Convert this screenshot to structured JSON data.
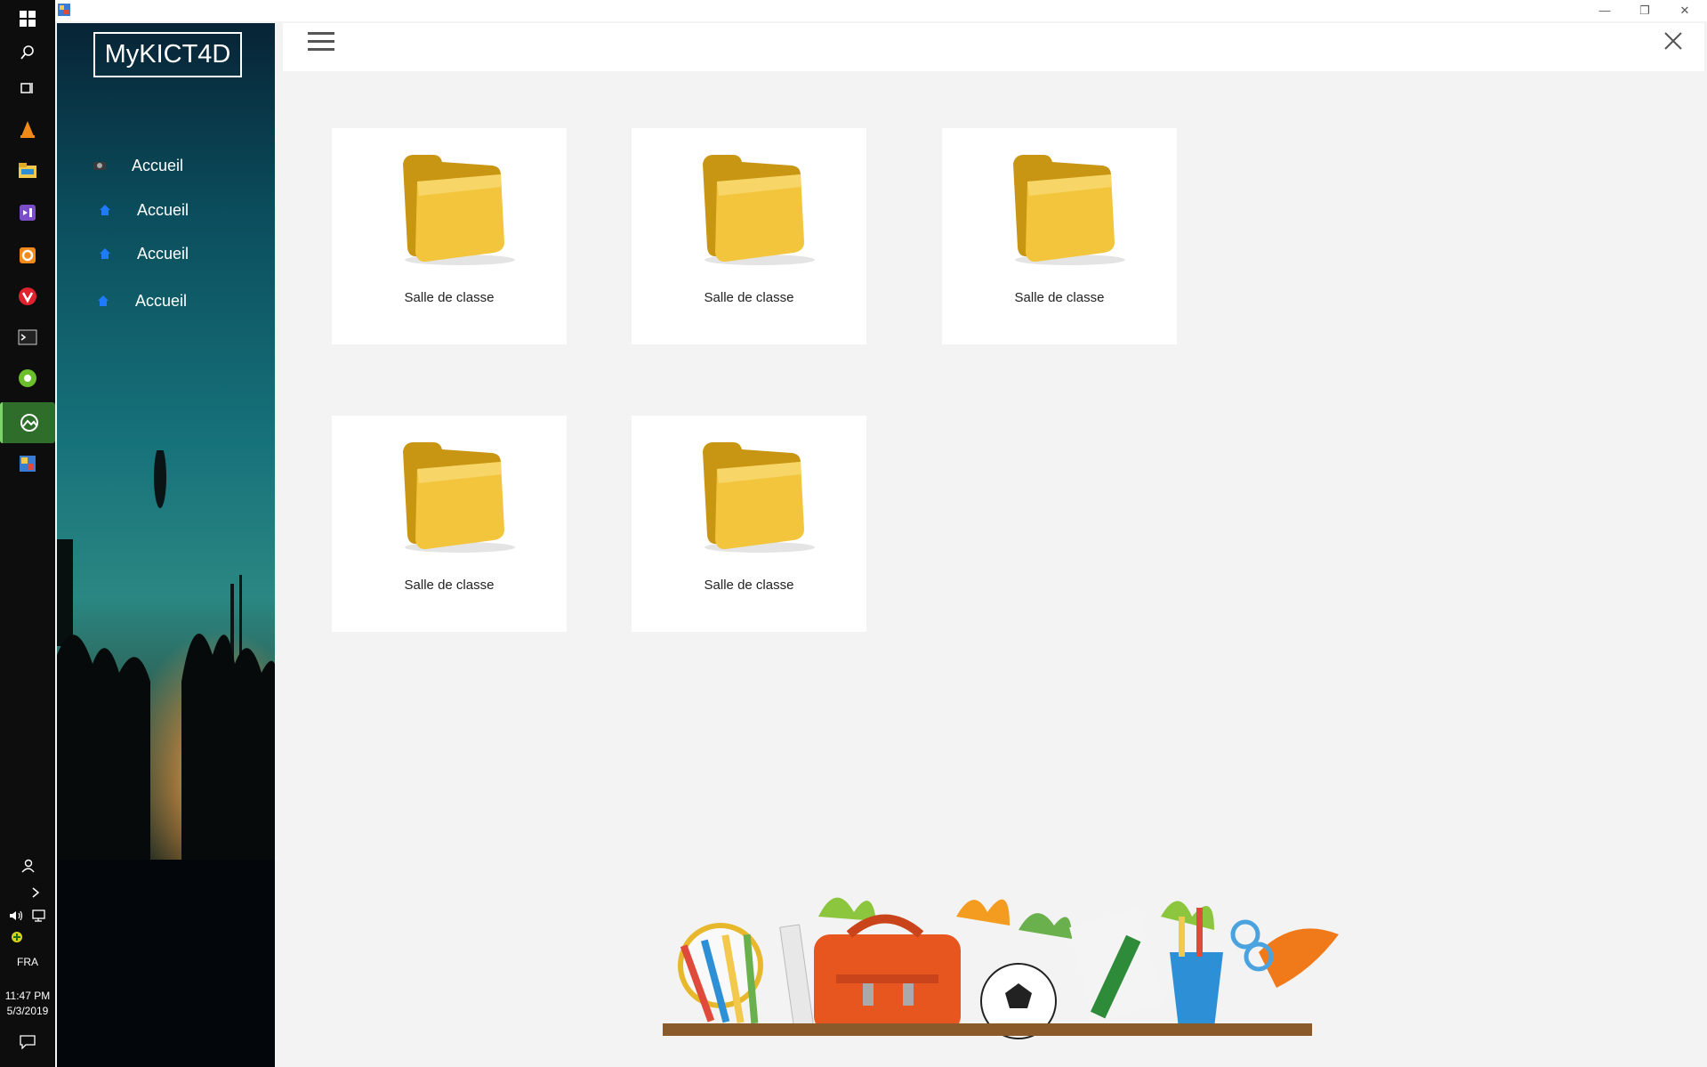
{
  "taskbar": {
    "language": "FRA",
    "time": "11:47 PM",
    "date": "5/3/2019"
  },
  "app": {
    "logo_text": "MyKICT4D"
  },
  "sidebar": {
    "items": [
      {
        "label": "Accueil",
        "icon": "app-icon"
      },
      {
        "label": "Accueil",
        "icon": "home-icon"
      },
      {
        "label": "Accueil",
        "icon": "home-icon"
      },
      {
        "label": "Accueil",
        "icon": "home-icon"
      }
    ]
  },
  "cards": [
    {
      "label": "Salle de classe",
      "icon": "folder-icon"
    },
    {
      "label": "Salle de classe",
      "icon": "folder-icon"
    },
    {
      "label": "Salle de classe",
      "icon": "folder-icon"
    },
    {
      "label": "Salle de classe",
      "icon": "folder-icon"
    },
    {
      "label": "Salle de classe",
      "icon": "folder-icon"
    }
  ],
  "colors": {
    "folder": "#e7b82c",
    "nav_icon": "#1e7bff",
    "background": "#f3f3f3"
  }
}
